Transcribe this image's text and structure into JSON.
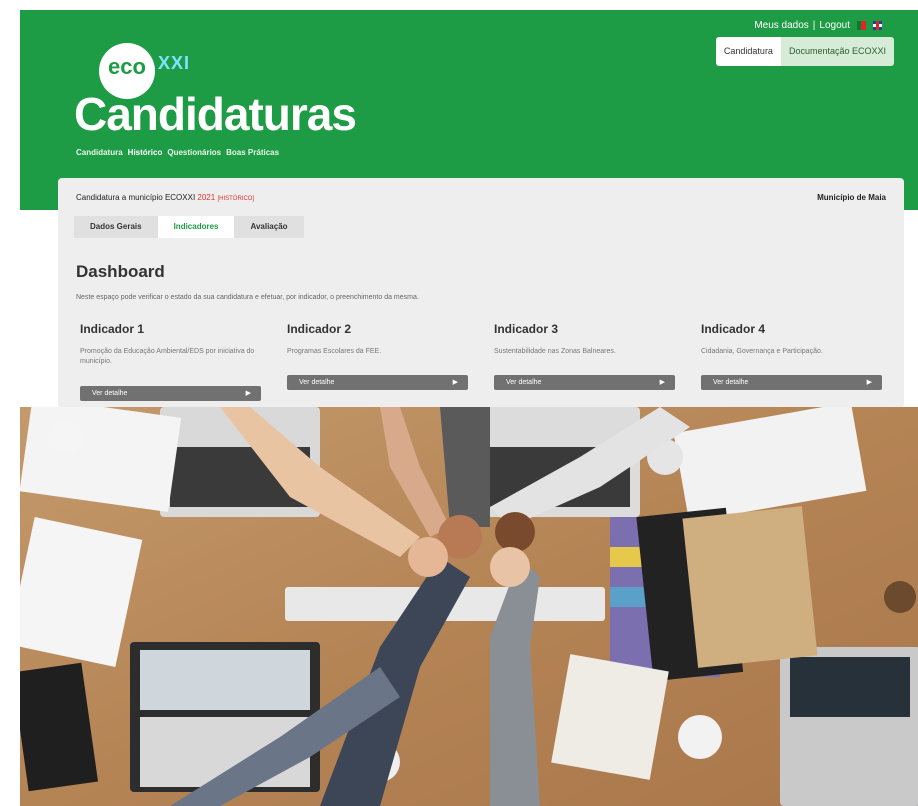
{
  "header": {
    "links": {
      "meus_dados": "Meus dados",
      "sep": "|",
      "logout": "Logout"
    },
    "flags": [
      "pt-flag-icon",
      "uk-flag-icon"
    ],
    "buttons": {
      "candidatura": "Candidatura",
      "documentacao": "Documentação ECOXXI"
    },
    "logo": {
      "eco": "eco",
      "xxi": "XXI"
    },
    "title": "Candidaturas",
    "nav": [
      "Candidatura",
      "Histórico",
      "Questionários",
      "Boas Práticas"
    ],
    "nav_active": "Histórico",
    "colors": {
      "brand_green": "#1e9c45",
      "accent_red": "#e03131"
    }
  },
  "card": {
    "heading_prefix": "Candidatura a município ECOXXI",
    "year": "2021",
    "status": "[HISTÓRICO]",
    "municipio": "Município de Maia",
    "tabs": [
      "Dados Gerais",
      "Indicadores",
      "Avaliação"
    ],
    "active_tab": "Indicadores",
    "dashboard_title": "Dashboard",
    "dashboard_desc": "Neste espaço pode verificar o estado da sua candidatura e efetuar, por indicador, o preenchimento da mesma.",
    "indicators": [
      {
        "title": "Indicador 1",
        "desc": "Promoção da Educação Ambiental/EDS por iniciativa do município.",
        "button": "Ver detalhe"
      },
      {
        "title": "Indicador 2",
        "desc": "Programas Escolares da FEE.",
        "button": "Ver detalhe"
      },
      {
        "title": "Indicador 3",
        "desc": "Sustentabilidade nas Zonas Balneares.",
        "button": "Ver detalhe"
      },
      {
        "title": "Indicador 4",
        "desc": "Cidadania, Governança e Participação.",
        "button": "Ver detalhe"
      }
    ]
  },
  "photo": {
    "subject": "teamwork-hands-photo"
  }
}
